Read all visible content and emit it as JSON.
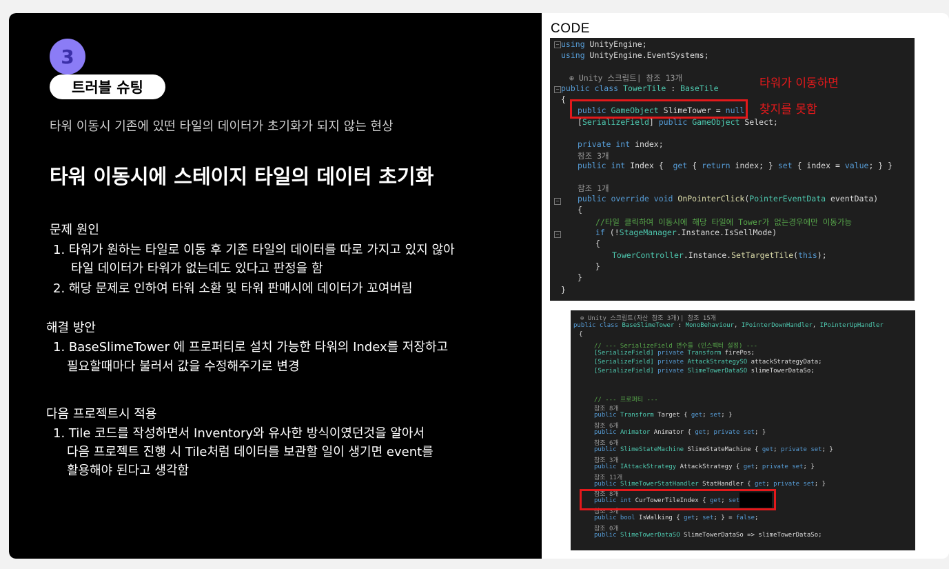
{
  "left": {
    "badge_number": "3",
    "badge_label": "트러블 슈팅",
    "subtitle": "타워 이동시 기존에 있떤 타일의 데이터가 초기화가 되지 않는 현상",
    "headline": "타워 이동시에 스테이지 타일의 데이터 초기화",
    "problem": {
      "title": "문제 원인",
      "items": [
        "1. 타워가 원하는 타일로 이동 후 기존 타일의 데이터를 따로 가지고 있지 않아",
        "타일 데이터가 타워가 없는데도 있다고 판정을 함",
        "2. 해당 문제로 인하여 타워 소환 및 타워 판매시에 데이터가 꼬여버림"
      ]
    },
    "solution": {
      "title": "해결 방안",
      "items": [
        "1. BaseSlimeTower 에 프로퍼티로 설치 가능한 타워의 Index를 저장하고",
        "필요할때마다 불러서 값을 수정해주기로 변경"
      ]
    },
    "next": {
      "title": "다음 프로젝트시 적용",
      "items": [
        "1. Tile 코드를 작성하면서 Inventory와 유사한 방식이였던것을 알아서",
        "다음 프로젝트 진행 시 Tile처럼 데이터를 보관할 일이 생기면 event를",
        "활용해야 된다고 생각함"
      ]
    }
  },
  "right": {
    "code_label": "CODE",
    "annotation_line1": "타워가 이동하면",
    "annotation_line2": "찾지를 못함",
    "code1": {
      "l1a": "using",
      "l1b": " UnityEngine;",
      "l2a": "using",
      "l2b": " UnityEngine.EventSystems;",
      "l3": "⊕ Unity 스크립트| 참조 13개",
      "l4a": "public class ",
      "l4b": "TowerTile",
      "l4c": " : ",
      "l4d": "BaseTile",
      "l5": "{",
      "l6a": "public ",
      "l6b": "GameObject",
      "l6c": " SlimeTower = ",
      "l6d": "null",
      "l6e": ";",
      "l7a": "[",
      "l7b": "SerializeField",
      "l7c": "] ",
      "l7d": "public ",
      "l7e": "GameObject",
      "l7f": " Select;",
      "l8a": "private int",
      "l8b": " index;",
      "l9": "참조 3개",
      "l10a": "public int",
      "l10b": " Index {  ",
      "l10c": "get",
      "l10d": " { ",
      "l10e": "return",
      "l10f": " index; } ",
      "l10g": "set",
      "l10h": " { index = ",
      "l10i": "value",
      "l10j": "; } }",
      "l11": "참조 1개",
      "l12a": "public override void ",
      "l12b": "OnPointerClick",
      "l12c": "(",
      "l12d": "PointerEventData",
      "l12e": " eventData)",
      "l13": "{",
      "l14": "//타일 클릭하여 이동시에 해당 타일에 Tower가 없는경우에만 이동가능",
      "l15a": "if",
      "l15b": " (!",
      "l15c": "StageManager",
      "l15d": ".Instance.IsSellMode)",
      "l16": "{",
      "l17a": "TowerController",
      "l17b": ".Instance.",
      "l17c": "SetTargetTile",
      "l17d": "(",
      "l17e": "this",
      "l17f": ");",
      "l18": "}",
      "l19": "}",
      "l20": "}"
    },
    "code2": {
      "l1": "⊕ Unity 스크립트(자산 참조 3개)| 참조 15개",
      "l2a": "public class ",
      "l2b": "BaseSlimeTower",
      "l2c": " : ",
      "l2d": "MonoBehaviour",
      "l2e": ", ",
      "l2f": "IPointerDownHandler",
      "l2g": ", ",
      "l2h": "IPointerUpHandler",
      "l3": "{",
      "l4": "// --- SerializeField 변수들 (인스펙터 설정) ---",
      "l5a": "[SerializeField] ",
      "l5b": "private ",
      "l5c": "Transform",
      "l5d": " firePos;",
      "l6a": "[SerializeField] ",
      "l6b": "private ",
      "l6c": "AttackStrategySO",
      "l6d": " attackStrategyData;",
      "l7a": "[SerializeField] ",
      "l7b": "private ",
      "l7c": "SlimeTowerDataSO",
      "l7d": " slimeTowerDataSo;",
      "l8": "// --- 프로퍼티 ---",
      "r1": "참조 8개",
      "p1a": "public ",
      "p1b": "Transform",
      "p1c": " Target { ",
      "p1d": "get",
      "p1e": "; ",
      "p1f": "set",
      "p1g": "; }",
      "r2": "참조 6개",
      "p2a": "public ",
      "p2b": "Animator",
      "p2c": " Animator { ",
      "p2d": "get",
      "p2e": "; ",
      "p2f": "private set",
      "p2g": "; }",
      "r3": "참조 6개",
      "p3a": "public ",
      "p3b": "SlimeStateMachine",
      "p3c": " SlimeStateMachine { ",
      "p3d": "get",
      "p3e": "; ",
      "p3f": "private set",
      "p3g": "; }",
      "r4": "참조 3개",
      "p4a": "public ",
      "p4b": "IAttackStrategy",
      "p4c": " AttackStrategy { ",
      "p4d": "get",
      "p4e": "; ",
      "p4f": "private set",
      "p4g": "; }",
      "r5": "참조 11개",
      "p5a": "public ",
      "p5b": "SlimeTowerStatHandler",
      "p5c": " StatHandler { ",
      "p5d": "get",
      "p5e": "; ",
      "p5f": "private set",
      "p5g": "; }",
      "r6": "참조 8개",
      "p6a": "public int",
      "p6b": " CurTowerTileIndex { ",
      "p6c": "get",
      "p6d": "; ",
      "p6e": "set",
      "p6f": "; }",
      "r7": "참조 3개",
      "p7a": "public bool",
      "p7b": " IsWalking { ",
      "p7c": "get",
      "p7d": "; ",
      "p7e": "set",
      "p7f": "; } = ",
      "p7g": "false",
      "p7h": ";",
      "r8": "참조 0개",
      "p8a": "public ",
      "p8b": "SlimeTowerDataSO",
      "p8c": " SlimeTowerDataSo => slimeTowerDataSo;"
    },
    "colors": {
      "accent_purple": "#8b7cf6",
      "highlight_red": "#e3191b",
      "code_bg": "#1e1e1e"
    }
  }
}
